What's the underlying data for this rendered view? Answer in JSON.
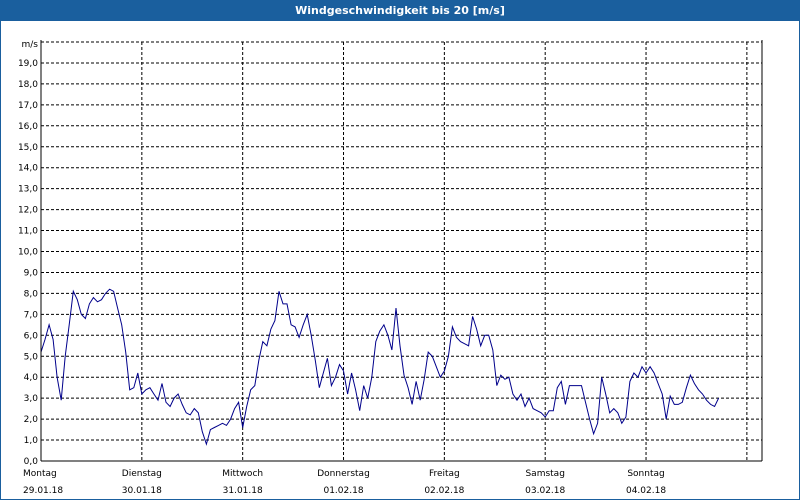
{
  "window": {
    "title": "Windgeschwindigkeit bis 20 [m/s]"
  },
  "colors": {
    "titlebar": "#1a5f9e",
    "series": "#00008b",
    "grid": "#000000"
  },
  "chart_data": {
    "type": "line",
    "title": "Windgeschwindigkeit bis 20 [m/s]",
    "ylabel": "m/s",
    "ylim": [
      0,
      20
    ],
    "yticks": [
      "0,0",
      "1,0",
      "2,0",
      "3,0",
      "4,0",
      "5,0",
      "6,0",
      "7,0",
      "8,0",
      "9,0",
      "10,0",
      "11,0",
      "12,0",
      "13,0",
      "14,0",
      "15,0",
      "16,0",
      "17,0",
      "18,0",
      "19,0"
    ],
    "x_unit": "days",
    "xlim": [
      0,
      7.15
    ],
    "grid": true,
    "days": [
      {
        "name": "Montag",
        "date": "29.01.18"
      },
      {
        "name": "Dienstag",
        "date": "30.01.18"
      },
      {
        "name": "Mittwoch",
        "date": "31.01.18"
      },
      {
        "name": "Donnerstag",
        "date": "01.02.18"
      },
      {
        "name": "Freitag",
        "date": "02.02.18"
      },
      {
        "name": "Samstag",
        "date": "03.02.18"
      },
      {
        "name": "Sonntag",
        "date": "04.02.18"
      }
    ],
    "series": [
      {
        "values": [
          [
            0.0,
            5.2
          ],
          [
            0.04,
            5.8
          ],
          [
            0.08,
            6.5
          ],
          [
            0.12,
            5.8
          ],
          [
            0.16,
            4.0
          ],
          [
            0.2,
            2.9
          ],
          [
            0.24,
            5.0
          ],
          [
            0.28,
            6.5
          ],
          [
            0.32,
            8.1
          ],
          [
            0.36,
            7.7
          ],
          [
            0.4,
            7.0
          ],
          [
            0.44,
            6.8
          ],
          [
            0.48,
            7.5
          ],
          [
            0.52,
            7.8
          ],
          [
            0.56,
            7.6
          ],
          [
            0.6,
            7.7
          ],
          [
            0.64,
            8.0
          ],
          [
            0.68,
            8.2
          ],
          [
            0.72,
            8.1
          ],
          [
            0.76,
            7.3
          ],
          [
            0.8,
            6.5
          ],
          [
            0.84,
            5.2
          ],
          [
            0.88,
            3.4
          ],
          [
            0.92,
            3.5
          ],
          [
            0.96,
            4.2
          ],
          [
            1.0,
            3.2
          ],
          [
            1.04,
            3.4
          ],
          [
            1.08,
            3.5
          ],
          [
            1.12,
            3.2
          ],
          [
            1.16,
            2.9
          ],
          [
            1.2,
            3.7
          ],
          [
            1.24,
            2.8
          ],
          [
            1.28,
            2.6
          ],
          [
            1.32,
            3.0
          ],
          [
            1.36,
            3.2
          ],
          [
            1.4,
            2.7
          ],
          [
            1.44,
            2.3
          ],
          [
            1.48,
            2.2
          ],
          [
            1.52,
            2.5
          ],
          [
            1.56,
            2.3
          ],
          [
            1.6,
            1.4
          ],
          [
            1.64,
            0.8
          ],
          [
            1.68,
            1.5
          ],
          [
            1.72,
            1.6
          ],
          [
            1.76,
            1.7
          ],
          [
            1.8,
            1.8
          ],
          [
            1.84,
            1.7
          ],
          [
            1.88,
            2.0
          ],
          [
            1.92,
            2.5
          ],
          [
            1.96,
            2.8
          ],
          [
            2.0,
            1.6
          ],
          [
            2.04,
            2.6
          ],
          [
            2.08,
            3.4
          ],
          [
            2.12,
            3.6
          ],
          [
            2.16,
            4.8
          ],
          [
            2.2,
            5.7
          ],
          [
            2.24,
            5.5
          ],
          [
            2.28,
            6.3
          ],
          [
            2.32,
            6.7
          ],
          [
            2.36,
            8.1
          ],
          [
            2.4,
            7.5
          ],
          [
            2.44,
            7.5
          ],
          [
            2.48,
            6.5
          ],
          [
            2.52,
            6.4
          ],
          [
            2.56,
            5.9
          ],
          [
            2.6,
            6.5
          ],
          [
            2.64,
            7.0
          ],
          [
            2.68,
            6.0
          ],
          [
            2.72,
            4.8
          ],
          [
            2.76,
            3.5
          ],
          [
            2.8,
            4.2
          ],
          [
            2.84,
            4.9
          ],
          [
            2.88,
            3.6
          ],
          [
            2.92,
            4.0
          ],
          [
            2.96,
            4.6
          ],
          [
            3.0,
            4.3
          ],
          [
            3.04,
            3.2
          ],
          [
            3.08,
            4.2
          ],
          [
            3.12,
            3.4
          ],
          [
            3.16,
            2.4
          ],
          [
            3.2,
            3.6
          ],
          [
            3.24,
            3.0
          ],
          [
            3.28,
            4.0
          ],
          [
            3.32,
            5.7
          ],
          [
            3.36,
            6.2
          ],
          [
            3.4,
            6.5
          ],
          [
            3.44,
            6.0
          ],
          [
            3.48,
            5.3
          ],
          [
            3.52,
            7.3
          ],
          [
            3.56,
            5.5
          ],
          [
            3.6,
            4.1
          ],
          [
            3.64,
            3.5
          ],
          [
            3.68,
            2.7
          ],
          [
            3.72,
            3.8
          ],
          [
            3.76,
            2.9
          ],
          [
            3.8,
            3.9
          ],
          [
            3.84,
            5.2
          ],
          [
            3.88,
            5.0
          ],
          [
            3.92,
            4.5
          ],
          [
            3.96,
            4.0
          ],
          [
            4.0,
            4.3
          ],
          [
            4.04,
            5.0
          ],
          [
            4.08,
            6.4
          ],
          [
            4.12,
            5.9
          ],
          [
            4.16,
            5.7
          ],
          [
            4.2,
            5.6
          ],
          [
            4.24,
            5.5
          ],
          [
            4.28,
            6.9
          ],
          [
            4.32,
            6.3
          ],
          [
            4.36,
            5.5
          ],
          [
            4.4,
            6.0
          ],
          [
            4.44,
            6.0
          ],
          [
            4.48,
            5.3
          ],
          [
            4.52,
            3.6
          ],
          [
            4.56,
            4.1
          ],
          [
            4.6,
            3.9
          ],
          [
            4.64,
            4.0
          ],
          [
            4.68,
            3.2
          ],
          [
            4.72,
            2.9
          ],
          [
            4.76,
            3.2
          ],
          [
            4.8,
            2.6
          ],
          [
            4.84,
            3.0
          ],
          [
            4.88,
            2.5
          ],
          [
            4.92,
            2.4
          ],
          [
            4.96,
            2.3
          ],
          [
            5.0,
            2.1
          ],
          [
            5.04,
            2.4
          ],
          [
            5.08,
            2.4
          ],
          [
            5.12,
            3.5
          ],
          [
            5.16,
            3.8
          ],
          [
            5.2,
            2.7
          ],
          [
            5.24,
            3.6
          ],
          [
            5.28,
            3.6
          ],
          [
            5.32,
            3.6
          ],
          [
            5.36,
            3.6
          ],
          [
            5.4,
            2.8
          ],
          [
            5.44,
            2.0
          ],
          [
            5.48,
            1.3
          ],
          [
            5.52,
            1.8
          ],
          [
            5.56,
            4.0
          ],
          [
            5.6,
            3.2
          ],
          [
            5.64,
            2.3
          ],
          [
            5.68,
            2.5
          ],
          [
            5.72,
            2.3
          ],
          [
            5.76,
            1.8
          ],
          [
            5.8,
            2.1
          ],
          [
            5.84,
            3.8
          ],
          [
            5.88,
            4.2
          ],
          [
            5.92,
            4.0
          ],
          [
            5.96,
            4.5
          ],
          [
            6.0,
            4.2
          ],
          [
            6.04,
            4.5
          ],
          [
            6.08,
            4.2
          ],
          [
            6.12,
            3.7
          ],
          [
            6.16,
            3.2
          ],
          [
            6.2,
            2.0
          ],
          [
            6.24,
            3.1
          ],
          [
            6.28,
            2.7
          ],
          [
            6.32,
            2.7
          ],
          [
            6.36,
            2.8
          ],
          [
            6.4,
            3.5
          ],
          [
            6.44,
            4.1
          ],
          [
            6.48,
            3.7
          ],
          [
            6.52,
            3.4
          ],
          [
            6.56,
            3.2
          ],
          [
            6.6,
            2.9
          ],
          [
            6.64,
            2.7
          ],
          [
            6.68,
            2.6
          ],
          [
            6.72,
            3.0
          ]
        ]
      }
    ]
  }
}
